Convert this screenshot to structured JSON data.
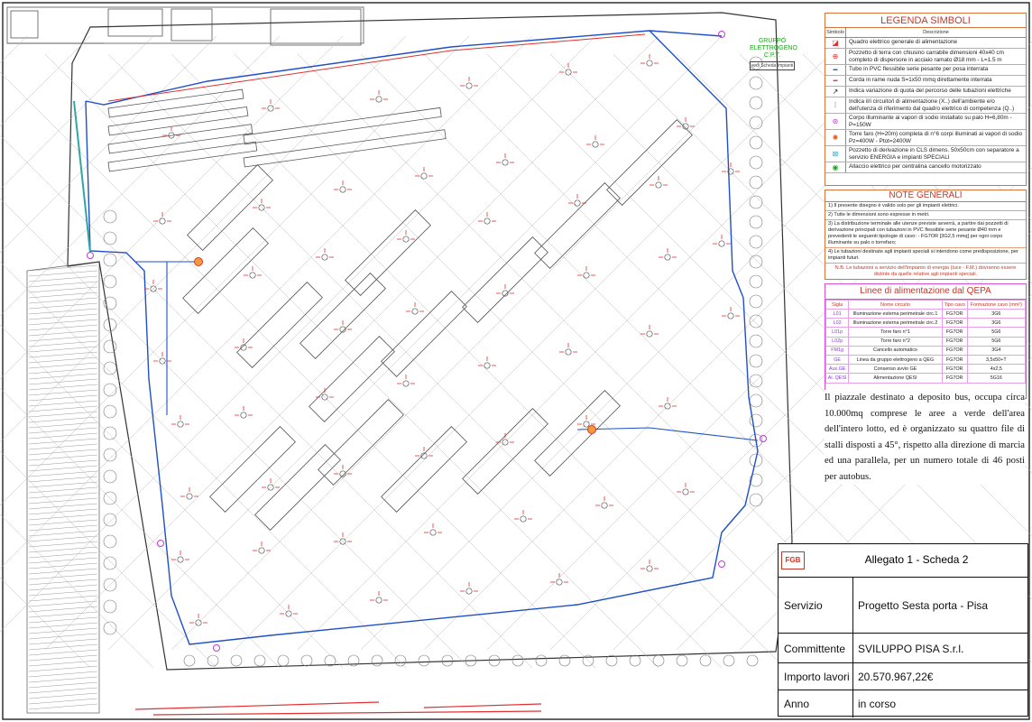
{
  "drawing": {
    "generator_label": "GRUPPO ELETTROGENO C.P.T.",
    "generator_sub": "vedi Scheda Impianti"
  },
  "legend": {
    "title": "LEGENDA SIMBOLI",
    "col_symbol": "Simbolo",
    "col_desc": "Descrizione",
    "rows": [
      {
        "icon": "main-panel-icon",
        "text": "Quadro elettrico generale di alimentazione"
      },
      {
        "icon": "earth-pit-icon",
        "text": "Pozzetto di terra con chiusino carrabile dimensioni 40x40 cm completo di dispersore in acciaio ramato Ø18 mm - L=1.5 m"
      },
      {
        "icon": "pvc-tube-icon",
        "text": "Tubo in PVC flessibile serie pesante per posa interrata"
      },
      {
        "icon": "copper-rope-icon",
        "text": "Corda in rame nuda S=1x50 mmq direttamente interrata"
      },
      {
        "icon": "elevation-change-icon",
        "text": "Indica variazione di quota del percorso delle tubazioni elettriche"
      },
      {
        "icon": "circuit-indicator-icon",
        "text": "Indica il/i circuito/i di alimentazione (X..) dell'ambiente e/o dell'utenza di riferimento dal quadro elettrico di competenza (Q..)"
      },
      {
        "icon": "sodium-lamp-icon",
        "text": "Corpo illuminante ai vapori di sodio installato su palo H=6,80m - P=150W"
      },
      {
        "icon": "light-tower-icon",
        "text": "Torre faro (H=20m) completa di n°6 corpi illuminati ai vapori di sodio Pz=400W - Ptot=2400W"
      },
      {
        "icon": "junction-pit-icon",
        "text": "Pozzetto di derivazione in CLS dimens. 50x50cm con separatore a servizio ENERGIA e impianti SPECIALI"
      },
      {
        "icon": "gate-connection-icon",
        "text": "Allaccio elettrico per centralina cancello motorizzato"
      }
    ]
  },
  "notes": {
    "title": "NOTE GENERALI",
    "items": [
      "1) Il presente disegno è valido solo per gli impianti elettrici.",
      "2) Tutte le dimensioni sono espresse in metri.",
      "3) La distribuzione terminale alle utenze previste avverrà, a partire dai pozzetti di derivazione principali con tubazioni in PVC flessibile serie pesante Ø40 mm e prevedenti le seguenti tipologie di cavo: - FG7OR [3G2,5 mmq] per ogni corpo illuminante su palo o torrefaro;",
      "4) Le tubazioni destinate agli impianti speciali si intendono come predisposizione, per impianti futuri."
    ],
    "nb": "N.B. Le tubazioni a servizio dell'impianto di energia (luce - F.M.) dovranno essere distinte da quelle relative agli impianti speciali."
  },
  "lines": {
    "title": "Linee di alimentazione dal QEPA",
    "headers": [
      "Sigla",
      "Nome circuito",
      "Tipo cavo",
      "Formazione cavo (mm²)"
    ],
    "rows": [
      [
        "L01",
        "Illuminazione esterna perimetrale circ.1",
        "FG7OR",
        "3G6"
      ],
      [
        "L02",
        "Illuminazione esterna perimetrale circ.2",
        "FG7OR",
        "3G6"
      ],
      [
        "L01p",
        "Torre faro n°1",
        "FG7OR",
        "5G6"
      ],
      [
        "L02p",
        "Torre faro n°2",
        "FG7OR",
        "5G6"
      ],
      [
        "FM1g",
        "Cancello automatico",
        "FG7OR",
        "3G4"
      ],
      [
        "GE",
        "Linea da gruppo elettrogeno a QEG",
        "FG7OR",
        "3,5x50+T"
      ],
      [
        "Aux.GE",
        "Consenso avvio GE",
        "FG7OR",
        "4x2,5"
      ],
      [
        "Al. QESI",
        "Alimentazione QESI",
        "FG7OR",
        "5G16"
      ]
    ]
  },
  "description": "Il piazzale destinato a deposito bus, occupa circa 10.000mq comprese le aree a verde dell'area dell'intero lotto, ed è organizzato su quattro file di stalli disposti a 45°, rispetto alla direzione di marcia ed una parallela, per un numero totale di 46 posti per autobus.",
  "title_block": {
    "logo": "FGB",
    "allegato": "Allegato 1 - Scheda 2",
    "servizio_label": "Servizio",
    "servizio": "Progetto Sesta porta - Pisa",
    "committente_label": "Committente",
    "committente": "SVILUPPO PISA S.r.l.",
    "importo_label": "Importo lavori",
    "importo": "20.570.967,22€",
    "anno_label": "Anno",
    "anno": "in corso"
  },
  "colors": {
    "accent": "#d9733b",
    "tube": "#1f4fc7",
    "rope": "#e23030",
    "lines_border": "#d64fd6",
    "generator": "#1fa51f"
  }
}
